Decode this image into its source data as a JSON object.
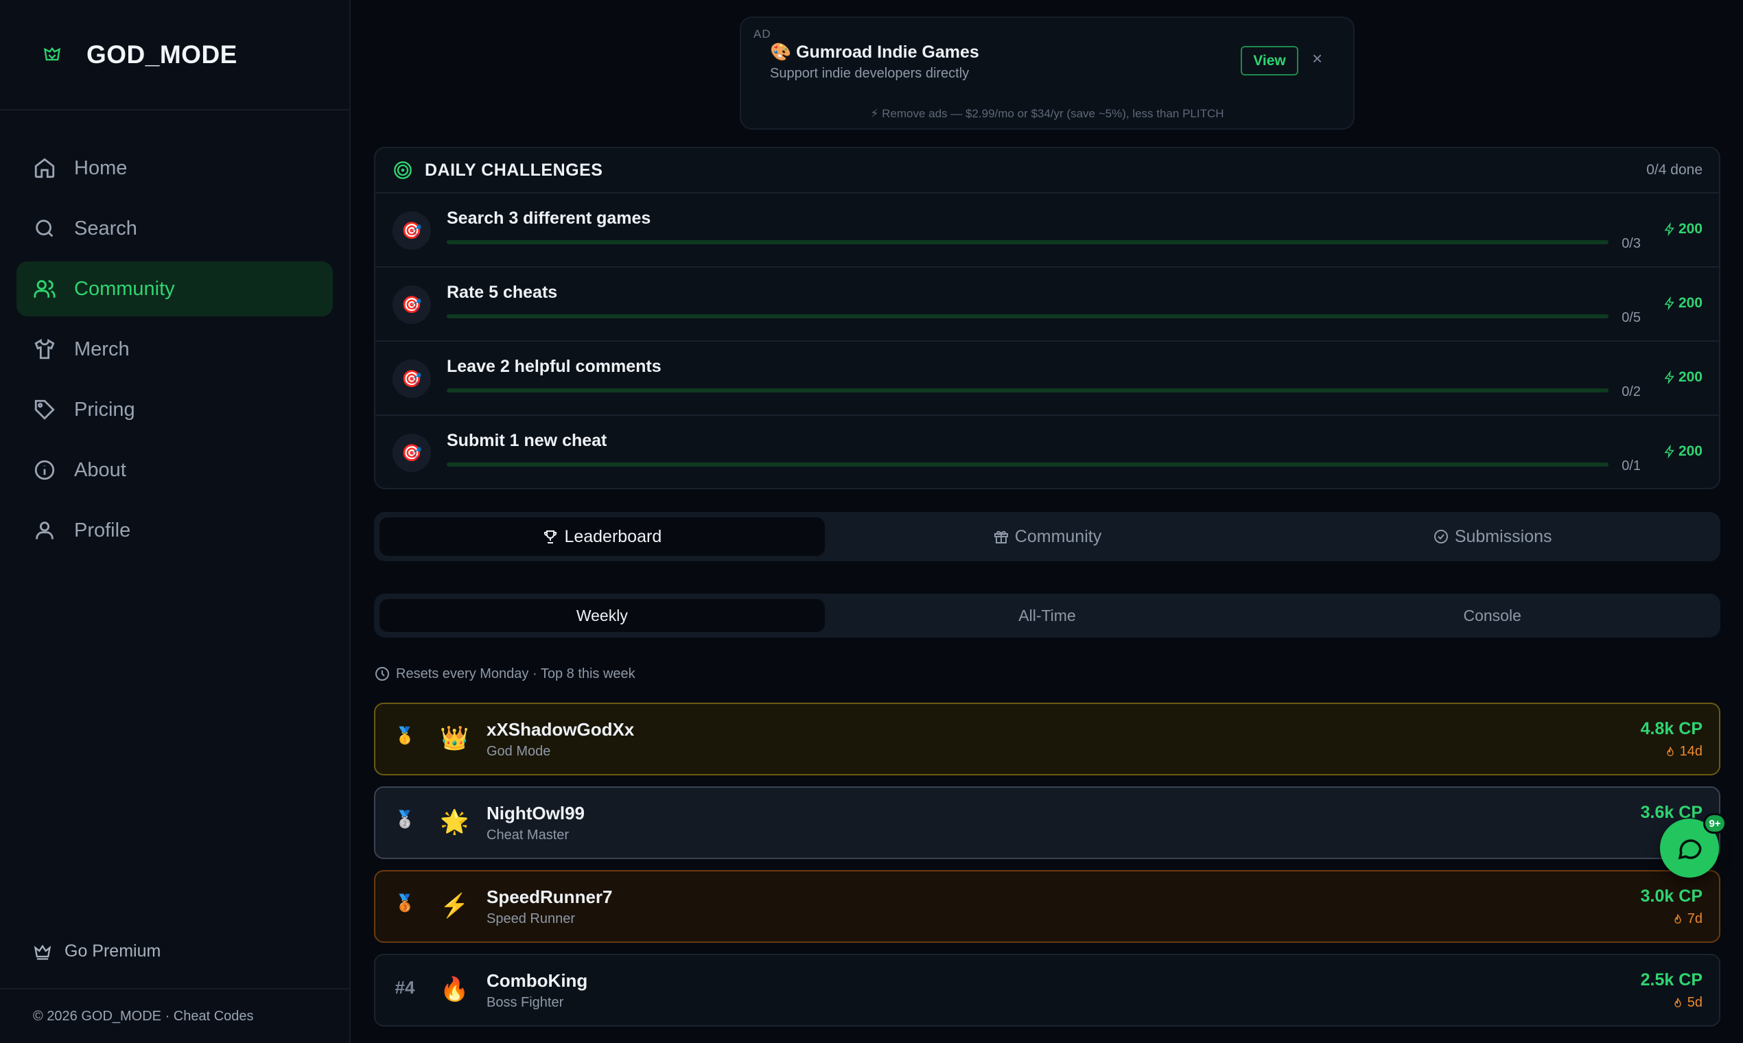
{
  "brand": {
    "name": "GOD_MODE",
    "accent": "#2fd571"
  },
  "nav": {
    "items": [
      {
        "label": "Home",
        "icon": "home-icon"
      },
      {
        "label": "Search",
        "icon": "search-icon"
      },
      {
        "label": "Community",
        "icon": "users-icon",
        "active": true
      },
      {
        "label": "Merch",
        "icon": "shirt-icon"
      },
      {
        "label": "Pricing",
        "icon": "tag-icon"
      },
      {
        "label": "About",
        "icon": "info-icon"
      },
      {
        "label": "Profile",
        "icon": "user-icon"
      }
    ],
    "premium": "Go Premium",
    "footer": "© 2026 GOD_MODE · Cheat Codes"
  },
  "ad": {
    "tag": "AD",
    "title": "🎨 Gumroad Indie Games",
    "subtitle": "Support indie developers directly",
    "view": "View",
    "close": "×",
    "remove": "Remove ads — $2.99/mo or $34/yr (save ~5%), less than PLITCH"
  },
  "challenges": {
    "title": "DAILY CHALLENGES",
    "count": "0/4 done",
    "items": [
      {
        "icon": "🎯",
        "title": "Search 3 different games",
        "progress": "0/3",
        "fraction": 0,
        "points": "200"
      },
      {
        "icon": "🎯",
        "title": "Rate 5 cheats",
        "progress": "0/5",
        "fraction": 0,
        "points": "200"
      },
      {
        "icon": "🎯",
        "title": "Leave 2 helpful comments",
        "progress": "0/2",
        "fraction": 0,
        "points": "200"
      },
      {
        "icon": "🎯",
        "title": "Submit 1 new cheat",
        "progress": "0/1",
        "fraction": 0,
        "points": "200"
      }
    ]
  },
  "tabs": {
    "items": [
      {
        "label": "Leaderboard",
        "icon": "trophy-icon",
        "active": true
      },
      {
        "label": "Community",
        "icon": "gift-icon"
      },
      {
        "label": "Submissions",
        "icon": "check-circle-icon"
      }
    ]
  },
  "periods": {
    "items": [
      {
        "label": "Weekly",
        "active": true
      },
      {
        "label": "All-Time"
      },
      {
        "label": "Console"
      }
    ]
  },
  "leaderboard": {
    "note": "Resets every Monday · Top 8 this week",
    "rows": [
      {
        "rank": "🥇",
        "emoji": "👑",
        "name": "xXShadowGodXx",
        "title": "God Mode",
        "cp": "4.8k CP",
        "streak": "14d",
        "tier": "gold"
      },
      {
        "rank": "🥈",
        "emoji": "🌟",
        "name": "NightOwl99",
        "title": "Cheat Master",
        "cp": "3.6k CP",
        "streak": "",
        "tier": "silver"
      },
      {
        "rank": "🥉",
        "emoji": "⚡",
        "name": "SpeedRunner7",
        "title": "Speed Runner",
        "cp": "3.0k CP",
        "streak": "7d",
        "tier": "bronze"
      },
      {
        "rank": "#4",
        "emoji": "🔥",
        "name": "ComboKing",
        "title": "Boss Fighter",
        "cp": "2.5k CP",
        "streak": "5d",
        "tier": "plain"
      }
    ]
  },
  "chat": {
    "badge": "9+"
  }
}
